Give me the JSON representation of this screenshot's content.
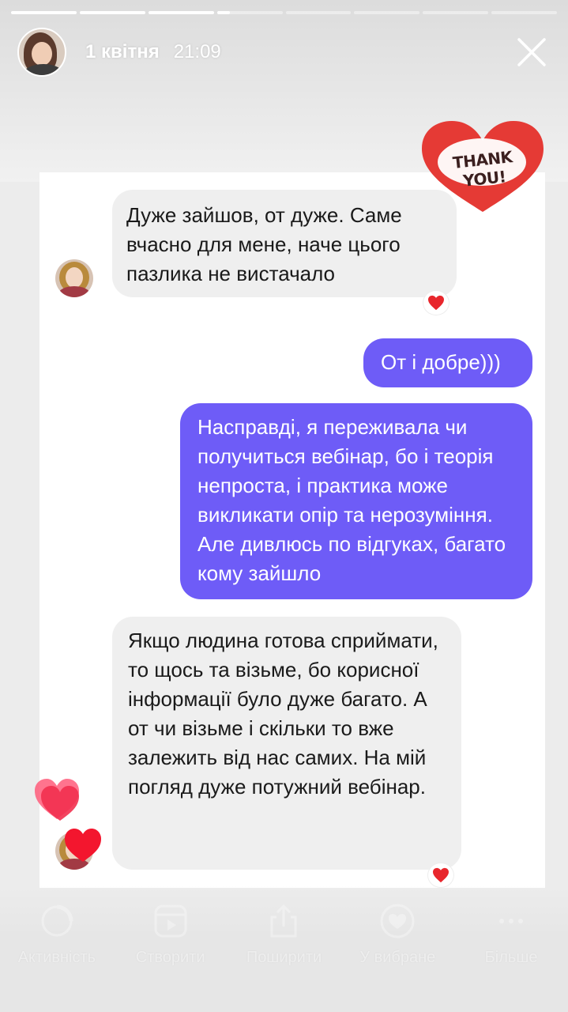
{
  "story": {
    "date": "1 квітня",
    "time": "21:09",
    "progress_segments": [
      1,
      1,
      1,
      0.2,
      0,
      0,
      0,
      0
    ]
  },
  "sticker": {
    "text": "THANK YOU!"
  },
  "messages": [
    {
      "side": "in",
      "text": "Дуже зайшов, от дуже. Саме вчасно для мене, наче цього пазлика не вистачало",
      "reaction": "heart"
    },
    {
      "side": "out",
      "text": "От і добре)))"
    },
    {
      "side": "out",
      "text": "Насправді, я переживала чи получиться вебінар, бо і теорія непроста, і практика може викликати опір та нерозуміння. Але дивлюсь по відгуках, багато кому зайшло"
    },
    {
      "side": "in",
      "text": "Якщо людина готова сприймати, то щось та візьме, бо корисної інформації було дуже багато. А от чи візьме і скільки то вже залежить від нас самих. На мій погляд дуже потужний вебінар.",
      "reaction": "heart"
    }
  ],
  "bottom_nav": [
    {
      "icon": "activity-icon",
      "label": "Активність"
    },
    {
      "icon": "create-icon",
      "label": "Створити"
    },
    {
      "icon": "share-icon",
      "label": "Поширити"
    },
    {
      "icon": "favorite-icon",
      "label": "У вибране"
    },
    {
      "icon": "more-icon",
      "label": "Більше"
    }
  ],
  "colors": {
    "outgoing_bubble": "#6e5cf7",
    "incoming_bubble": "#efefef",
    "heart": "#e8262c"
  }
}
